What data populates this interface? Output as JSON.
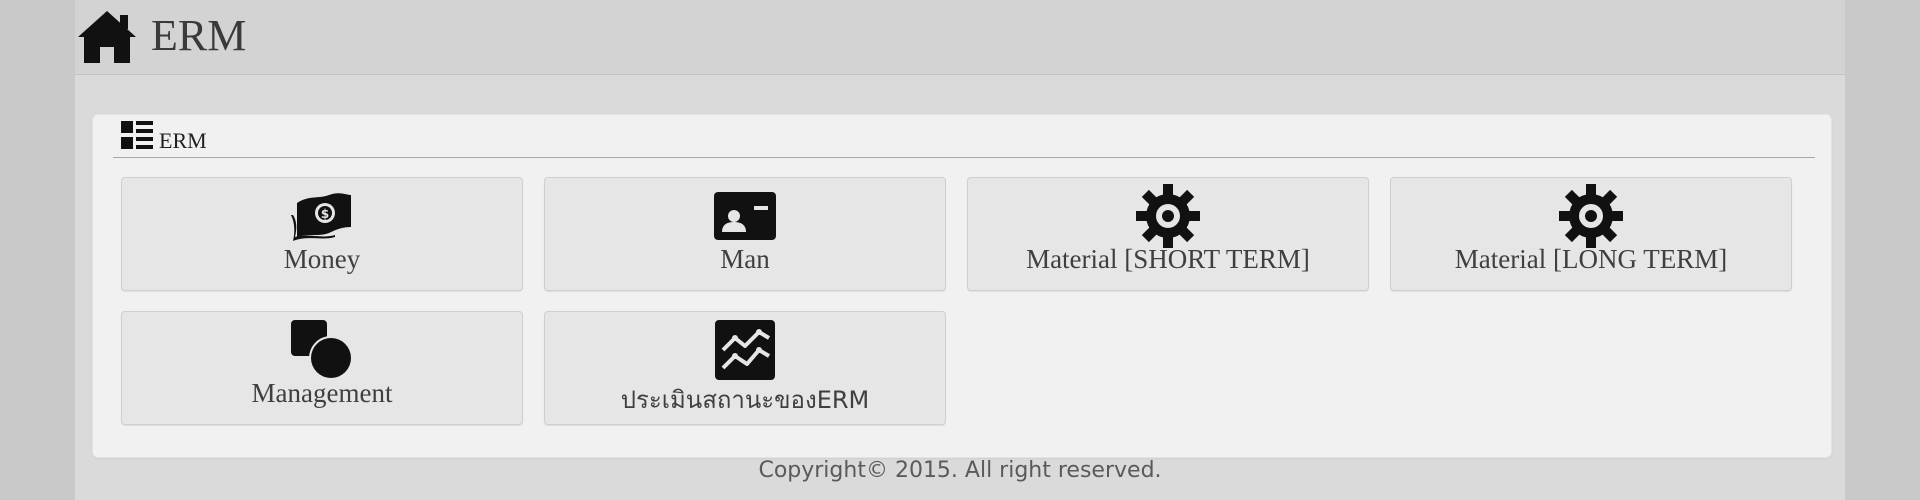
{
  "header": {
    "title": "ERM",
    "icon": "home-icon"
  },
  "panel": {
    "title": "ERM",
    "icon": "list-icon",
    "tiles": [
      {
        "label": "Money",
        "icon": "money-icon"
      },
      {
        "label": "Man",
        "icon": "id-card-icon"
      },
      {
        "label": "Material [SHORT TERM]",
        "icon": "gear-icon"
      },
      {
        "label": "Material [LONG TERM]",
        "icon": "gear-icon"
      },
      {
        "label": "Management",
        "icon": "shapes-icon"
      },
      {
        "label": "ประเมินสถานะของERM",
        "icon": "chart-line-icon"
      }
    ]
  },
  "footer": {
    "copyright": "Copyright© 2015. All right reserved."
  }
}
